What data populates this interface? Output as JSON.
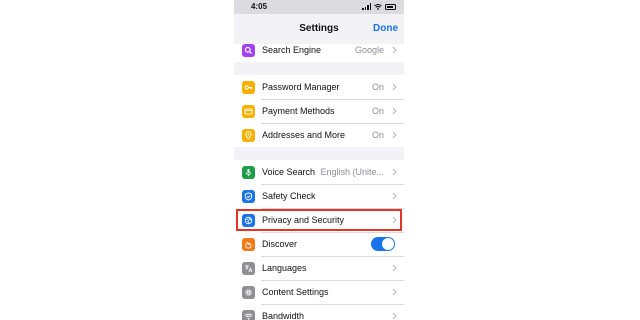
{
  "status_bar": {
    "time": "4:05"
  },
  "nav": {
    "title": "Settings",
    "done_label": "Done"
  },
  "groups": [
    {
      "rows": [
        {
          "label": "Search Engine",
          "value": "Google",
          "icon": "search-icon",
          "icon_color": "#a142f4"
        }
      ]
    },
    {
      "rows": [
        {
          "label": "Password Manager",
          "value": "On",
          "icon": "key-icon",
          "icon_color": "#f6b100"
        },
        {
          "label": "Payment Methods",
          "value": "On",
          "icon": "card-icon",
          "icon_color": "#f6b100"
        },
        {
          "label": "Addresses and More",
          "value": "On",
          "icon": "location-pin-icon",
          "icon_color": "#f6b100"
        }
      ]
    },
    {
      "rows": [
        {
          "label": "Voice Search",
          "value": "English (Unite...",
          "icon": "microphone-icon",
          "icon_color": "#1e9e4a"
        },
        {
          "label": "Safety Check",
          "value": "",
          "icon": "shield-icon",
          "icon_color": "#1a73e8"
        },
        {
          "label": "Privacy and Security",
          "value": "",
          "icon": "globe-icon",
          "icon_color": "#1a73e8"
        },
        {
          "label": "Discover",
          "value": "",
          "icon": "flame-icon",
          "icon_color": "#f07a1a",
          "toggle": true
        },
        {
          "label": "Languages",
          "value": "",
          "icon": "translate-icon",
          "icon_color": "#8e8e93"
        },
        {
          "label": "Content Settings",
          "value": "",
          "icon": "gear-icon",
          "icon_color": "#8e8e93"
        },
        {
          "label": "Bandwidth",
          "value": "",
          "icon": "wifi-icon",
          "icon_color": "#8e8e93"
        }
      ]
    }
  ],
  "highlight_color": "#e53324"
}
